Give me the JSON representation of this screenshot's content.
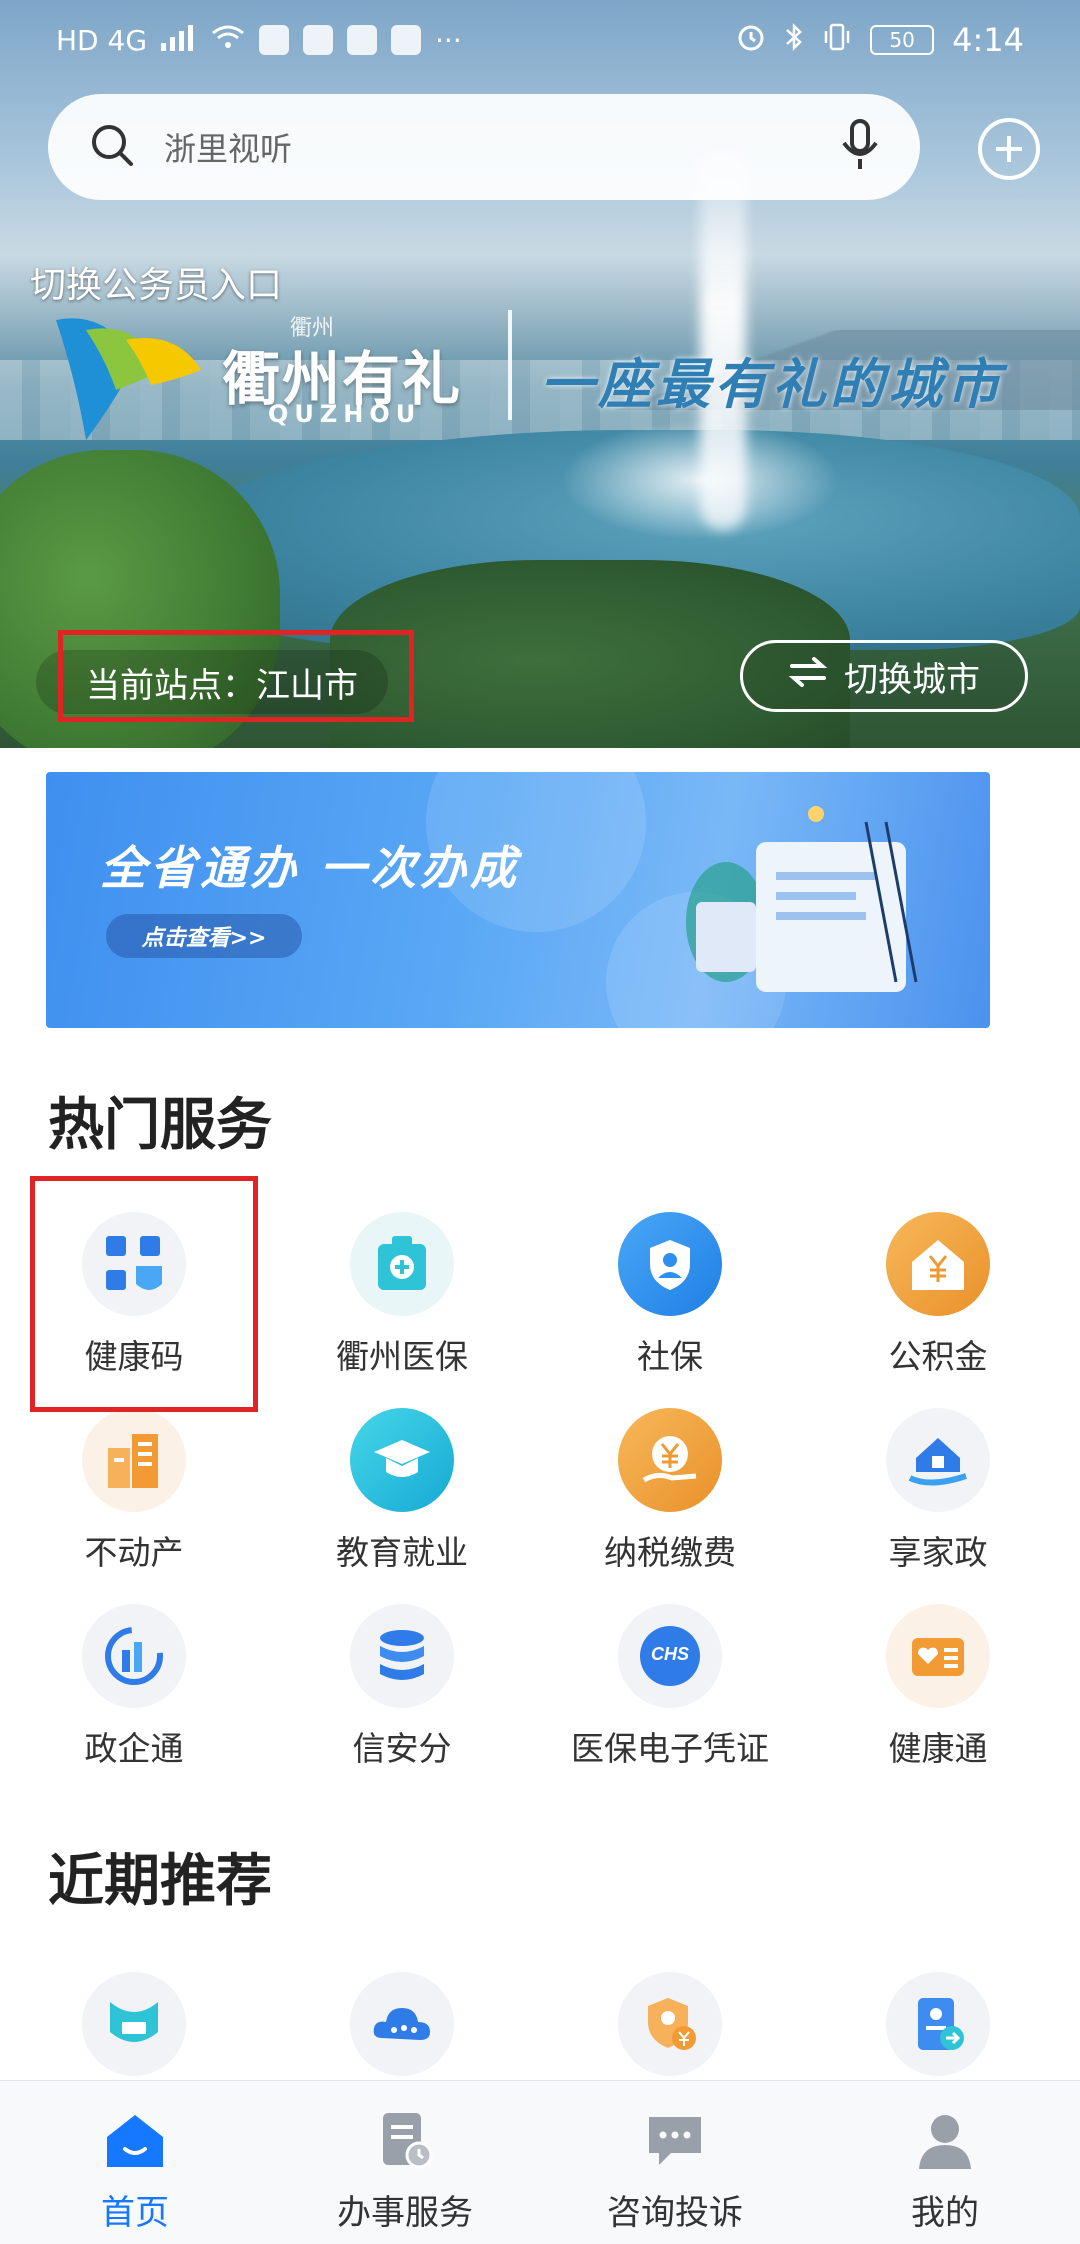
{
  "status_bar": {
    "left_text": "HD 4G",
    "battery": "50",
    "time": "4:14"
  },
  "search": {
    "placeholder": "浙里视听"
  },
  "hero": {
    "civil_servant_entry": "切换公务员入口",
    "logo_small": "衢州",
    "logo_city": "衢州有礼",
    "logo_en": "QUZHOU",
    "slogan": "一座最有礼的城市",
    "current_station": "当前站点：江山市",
    "switch_city": "切换城市"
  },
  "banner": {
    "title": "全省通办  一次办成",
    "button": "点击查看>>"
  },
  "hot_services": {
    "title": "热门服务",
    "items": [
      {
        "label": "健康码",
        "icon": "qr-code-icon"
      },
      {
        "label": "衢州医保",
        "icon": "medical-kit-icon"
      },
      {
        "label": "社保",
        "icon": "shield-user-icon"
      },
      {
        "label": "公积金",
        "icon": "house-yuan-icon"
      },
      {
        "label": "不动产",
        "icon": "building-icon"
      },
      {
        "label": "教育就业",
        "icon": "graduation-cap-icon"
      },
      {
        "label": "纳税缴费",
        "icon": "tax-yuan-icon"
      },
      {
        "label": "享家政",
        "icon": "home-hand-icon"
      },
      {
        "label": "政企通",
        "icon": "enterprise-chart-icon"
      },
      {
        "label": "信安分",
        "icon": "database-icon"
      },
      {
        "label": "医保电子凭证",
        "icon": "chs-icon"
      },
      {
        "label": "健康通",
        "icon": "health-card-icon"
      }
    ]
  },
  "recommend": {
    "title": "近期推荐",
    "items": [
      {
        "icon": "leaf-icon"
      },
      {
        "icon": "cloud-icon"
      },
      {
        "icon": "shield-yuan-icon"
      },
      {
        "icon": "id-card-arrow-icon"
      }
    ]
  },
  "bottom_nav": {
    "items": [
      {
        "label": "首页",
        "icon": "home-icon"
      },
      {
        "label": "办事服务",
        "icon": "document-clock-icon"
      },
      {
        "label": "咨询投诉",
        "icon": "chat-icon"
      },
      {
        "label": "我的",
        "icon": "user-icon"
      }
    ]
  },
  "colors": {
    "accent": "#1677ff",
    "highlight_box": "#e02424"
  }
}
